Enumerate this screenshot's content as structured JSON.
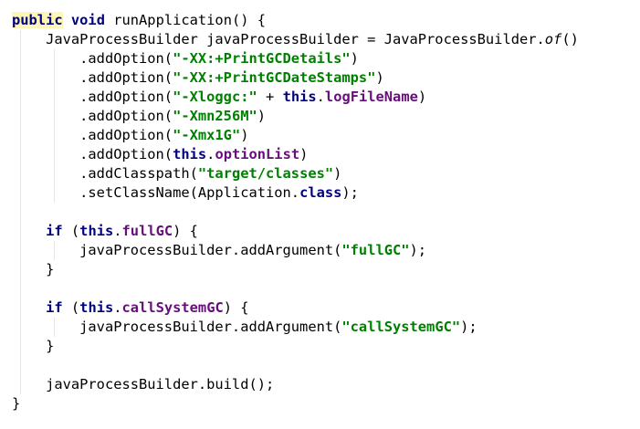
{
  "code": {
    "lines": [
      {
        "indent": 0,
        "tokens": [
          {
            "text": "public",
            "kind": "kw",
            "highlight": true
          },
          {
            "text": " "
          },
          {
            "text": "void",
            "kind": "kw"
          },
          {
            "text": " runApplication() {"
          }
        ]
      },
      {
        "indent": 1,
        "tokens": [
          {
            "text": "JavaProcessBuilder javaProcessBuilder = JavaProcessBuilder."
          },
          {
            "text": "of",
            "kind": "static-call"
          },
          {
            "text": "()"
          }
        ]
      },
      {
        "indent": 2,
        "tokens": [
          {
            "text": ".addOption("
          },
          {
            "text": "\"-XX:+PrintGCDetails\"",
            "kind": "str"
          },
          {
            "text": ")"
          }
        ]
      },
      {
        "indent": 2,
        "tokens": [
          {
            "text": ".addOption("
          },
          {
            "text": "\"-XX:+PrintGCDateStamps\"",
            "kind": "str"
          },
          {
            "text": ")"
          }
        ]
      },
      {
        "indent": 2,
        "tokens": [
          {
            "text": ".addOption("
          },
          {
            "text": "\"-Xloggc:\"",
            "kind": "str"
          },
          {
            "text": " + "
          },
          {
            "text": "this",
            "kind": "kw"
          },
          {
            "text": "."
          },
          {
            "text": "logFileName",
            "kind": "field"
          },
          {
            "text": ")"
          }
        ]
      },
      {
        "indent": 2,
        "tokens": [
          {
            "text": ".addOption("
          },
          {
            "text": "\"-Xmn256M\"",
            "kind": "str"
          },
          {
            "text": ")"
          }
        ]
      },
      {
        "indent": 2,
        "tokens": [
          {
            "text": ".addOption("
          },
          {
            "text": "\"-Xmx1G\"",
            "kind": "str"
          },
          {
            "text": ")"
          }
        ]
      },
      {
        "indent": 2,
        "tokens": [
          {
            "text": ".addOption("
          },
          {
            "text": "this",
            "kind": "kw"
          },
          {
            "text": "."
          },
          {
            "text": "optionList",
            "kind": "field"
          },
          {
            "text": ")"
          }
        ]
      },
      {
        "indent": 2,
        "tokens": [
          {
            "text": ".addClasspath("
          },
          {
            "text": "\"target/classes\"",
            "kind": "str"
          },
          {
            "text": ")"
          }
        ]
      },
      {
        "indent": 2,
        "tokens": [
          {
            "text": ".setClassName(Application."
          },
          {
            "text": "class",
            "kind": "kw"
          },
          {
            "text": ");"
          }
        ]
      },
      {
        "indent": 0,
        "tokens": []
      },
      {
        "indent": 1,
        "tokens": [
          {
            "text": "if",
            "kind": "kw"
          },
          {
            "text": " ("
          },
          {
            "text": "this",
            "kind": "kw"
          },
          {
            "text": "."
          },
          {
            "text": "fullGC",
            "kind": "field"
          },
          {
            "text": ") {"
          }
        ]
      },
      {
        "indent": 2,
        "tokens": [
          {
            "text": "javaProcessBuilder.addArgument("
          },
          {
            "text": "\"fullGC\"",
            "kind": "str"
          },
          {
            "text": ");"
          }
        ]
      },
      {
        "indent": 1,
        "tokens": [
          {
            "text": "}"
          }
        ]
      },
      {
        "indent": 0,
        "tokens": []
      },
      {
        "indent": 1,
        "tokens": [
          {
            "text": "if",
            "kind": "kw"
          },
          {
            "text": " ("
          },
          {
            "text": "this",
            "kind": "kw"
          },
          {
            "text": "."
          },
          {
            "text": "callSystemGC",
            "kind": "field"
          },
          {
            "text": ") {"
          }
        ]
      },
      {
        "indent": 2,
        "tokens": [
          {
            "text": "javaProcessBuilder.addArgument("
          },
          {
            "text": "\"callSystemGC\"",
            "kind": "str"
          },
          {
            "text": ");"
          }
        ]
      },
      {
        "indent": 1,
        "tokens": [
          {
            "text": "}"
          }
        ]
      },
      {
        "indent": 0,
        "tokens": []
      },
      {
        "indent": 1,
        "tokens": [
          {
            "text": "javaProcessBuilder.build();"
          }
        ]
      },
      {
        "indent": 0,
        "tokens": [
          {
            "text": "}"
          }
        ]
      }
    ]
  },
  "colors": {
    "keyword": "#000080",
    "string": "#008000",
    "field": "#660e7a",
    "text": "#000000",
    "background": "#ffffff",
    "highlight": "#fdf6b7",
    "indent_guide": "#e6e6e6"
  }
}
